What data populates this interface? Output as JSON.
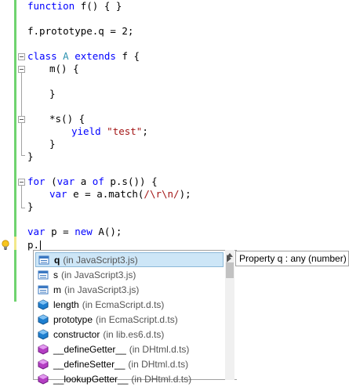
{
  "code": {
    "line1": {
      "kw": "function",
      "rest": " f() { }"
    },
    "line2": {
      "a": "f.prototype.q = 2;"
    },
    "line3": {
      "kw1": "class",
      "cls": "A",
      "kw2": "extends",
      "rest": " f {"
    },
    "line4": {
      "a": "m() {"
    },
    "line5": {
      "a": "}"
    },
    "line6": {
      "a": "*s() {"
    },
    "line7": {
      "kw": "yield",
      "str": "\"test\"",
      "rest": ";"
    },
    "line8": {
      "a": "}"
    },
    "line9": {
      "a": "}"
    },
    "line10": {
      "kw1": "for",
      "mid1": " (",
      "kw2": "var",
      "mid2": " a ",
      "kw3": "of",
      "rest": " p.s()) {"
    },
    "line11": {
      "kw": "var",
      "rest1": " e = a.match(",
      "str": "/\\r\\n/",
      "rest2": ");"
    },
    "line12": {
      "a": "}"
    },
    "line13": {
      "kw1": "var",
      "mid": " p = ",
      "kw2": "new",
      "rest": " A();"
    },
    "line14": {
      "a": "p."
    }
  },
  "completion": {
    "items": [
      {
        "name": "q",
        "source": "(in JavaScript3.js)",
        "icon": "field-icon",
        "selected": true
      },
      {
        "name": "s",
        "source": "(in JavaScript3.js)",
        "icon": "field-icon"
      },
      {
        "name": "m",
        "source": "(in JavaScript3.js)",
        "icon": "field-icon"
      },
      {
        "name": "length",
        "source": "(in EcmaScript.d.ts)",
        "icon": "property-icon"
      },
      {
        "name": "prototype",
        "source": "(in EcmaScript.d.ts)",
        "icon": "property-icon"
      },
      {
        "name": "constructor",
        "source": "(in lib.es6.d.ts)",
        "icon": "property-icon"
      },
      {
        "name": "__defineGetter__",
        "source": "(in DHtml.d.ts)",
        "icon": "method-icon"
      },
      {
        "name": "__defineSetter__",
        "source": "(in DHtml.d.ts)",
        "icon": "method-icon"
      },
      {
        "name": "__lookupGetter__",
        "source": "(in DHtml.d.ts)",
        "icon": "method-icon"
      }
    ]
  },
  "tooltip": {
    "text": "Property q : any (number)"
  },
  "colors": {
    "keyword": "#0000ff",
    "string": "#a31515",
    "class": "#2b91af",
    "gutter_green": "#6fd36f",
    "selection": "#cde6f7"
  }
}
